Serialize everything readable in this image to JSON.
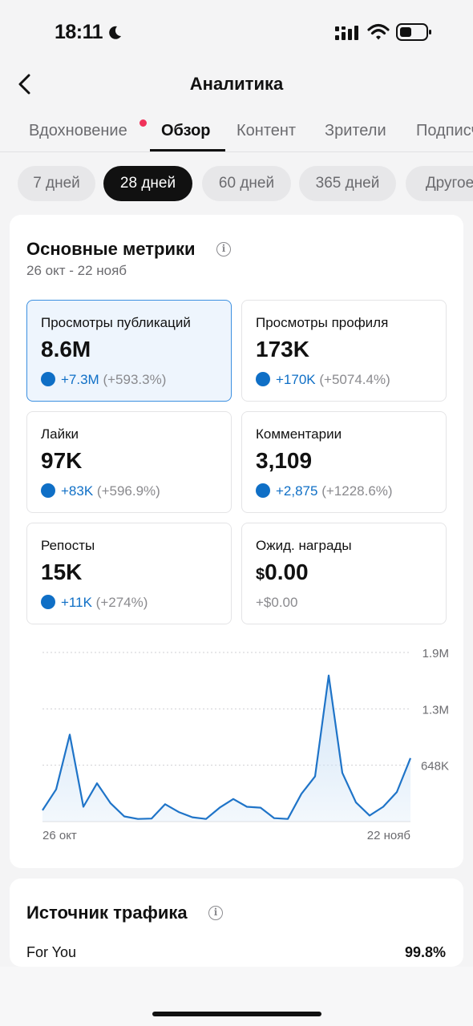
{
  "status_bar": {
    "time": "18:11"
  },
  "nav": {
    "title": "Аналитика"
  },
  "tabs": [
    {
      "label": "Вдохновение"
    },
    {
      "label": "Обзор"
    },
    {
      "label": "Контент"
    },
    {
      "label": "Зрители"
    },
    {
      "label": "Подписчики"
    }
  ],
  "active_tab": "Обзор",
  "periods": [
    {
      "label": "7 дней"
    },
    {
      "label": "28 дней"
    },
    {
      "label": "60 дней"
    },
    {
      "label": "365 дней"
    },
    {
      "label": "Другое"
    }
  ],
  "selected_period": "28 дней",
  "metrics_card": {
    "title": "Основные метрики",
    "date_range": "26 окт - 22 нояб",
    "metrics": [
      {
        "label": "Просмотры публикаций",
        "value": "8.6M",
        "change": "+7.3M",
        "change_pct": "(+593.3%)"
      },
      {
        "label": "Просмотры профиля",
        "value": "173K",
        "change": "+170K",
        "change_pct": "(+5074.4%)"
      },
      {
        "label": "Лайки",
        "value": "97K",
        "change": "+83K",
        "change_pct": "(+596.9%)"
      },
      {
        "label": "Комментарии",
        "value": "3,109",
        "change": "+2,875",
        "change_pct": "(+1228.6%)"
      },
      {
        "label": "Репосты",
        "value": "15K",
        "change": "+11K",
        "change_pct": "(+274%)"
      },
      {
        "label": "Ожид. награды",
        "currency": "$",
        "value": "0.00",
        "change": "+$0.00"
      }
    ]
  },
  "chart_data": {
    "type": "area",
    "y_tick_labels": [
      "1.9M",
      "1.3M",
      "648K"
    ],
    "y_ticks": [
      1944000,
      1296000,
      648000
    ],
    "ylim": [
      0,
      1944000
    ],
    "x_tick_labels": [
      "26 окт",
      "22 нояб"
    ],
    "x": [
      "26 окт",
      "27 окт",
      "28 окт",
      "29 окт",
      "30 окт",
      "31 окт",
      "1 нояб",
      "2 нояб",
      "3 нояб",
      "4 нояб",
      "5 нояб",
      "6 нояб",
      "7 нояб",
      "8 нояб",
      "9 нояб",
      "10 нояб",
      "11 нояб",
      "12 нояб",
      "13 нояб",
      "14 нояб",
      "15 нояб",
      "16 нояб",
      "17 нояб",
      "18 нояб",
      "19 нояб",
      "20 нояб",
      "21 нояб",
      "22 нояб"
    ],
    "values": [
      130000,
      370000,
      1000000,
      170000,
      440000,
      210000,
      60000,
      30000,
      35000,
      200000,
      110000,
      50000,
      30000,
      160000,
      260000,
      170000,
      160000,
      40000,
      30000,
      320000,
      520000,
      1680000,
      560000,
      220000,
      70000,
      170000,
      340000,
      730000
    ],
    "color": "#1f74c8",
    "fill": "#cfe3f6",
    "grid": true
  },
  "traffic": {
    "title": "Источник трафика",
    "sources": [
      {
        "label": "For You",
        "value": "99.8%",
        "share": 0.998
      }
    ]
  }
}
